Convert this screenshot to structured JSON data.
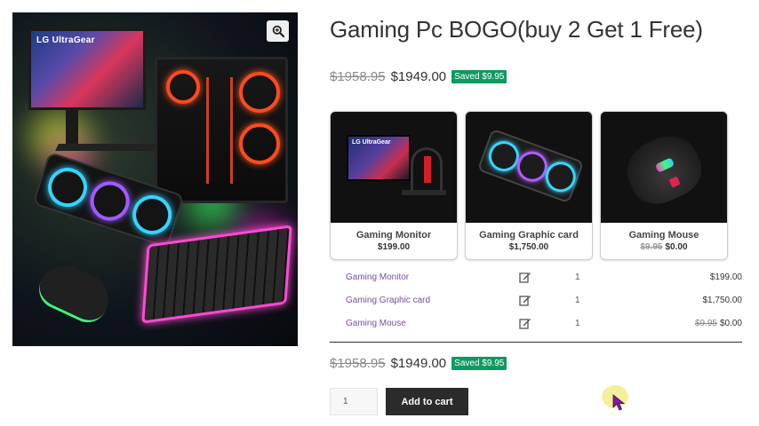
{
  "product": {
    "title": "Gaming Pc BOGO(buy 2 Get 1 Free)",
    "hero_image_brand": "LG UltraGear"
  },
  "pricing_top": {
    "old_price": "$1958.95",
    "new_price": "$1949.00",
    "saved": "Saved $9.95"
  },
  "cards": [
    {
      "name": "Gaming Monitor",
      "price": "$199.00",
      "old_price": "",
      "image_brand": "LG UltraGear"
    },
    {
      "name": "Gaming Graphic card",
      "price": "$1,750.00",
      "old_price": ""
    },
    {
      "name": "Gaming Mouse",
      "price": "$0.00",
      "old_price": "$9.95"
    }
  ],
  "bundle_rows": [
    {
      "name": "Gaming Monitor",
      "qty": "1",
      "old_price": "",
      "price": "$199.00",
      "edit_icon": "edit-icon"
    },
    {
      "name": "Gaming Graphic card",
      "qty": "1",
      "old_price": "",
      "price": "$1,750.00",
      "edit_icon": "edit-icon"
    },
    {
      "name": "Gaming Mouse",
      "qty": "1",
      "old_price": "$9.95",
      "price": "$0.00",
      "edit_icon": "edit-icon"
    }
  ],
  "pricing_bottom": {
    "old_price": "$1958.95",
    "new_price": "$1949.00",
    "saved": "Saved $9.95"
  },
  "cart": {
    "quantity": "1",
    "add_to_cart_label": "Add to cart"
  },
  "icons": {
    "zoom": "zoom-in-icon",
    "cursor": "mouse-pointer-icon"
  },
  "colors": {
    "saved_badge": "#0f9960",
    "link_purple": "#7a4ea3",
    "button_dark": "#2b2b2b"
  }
}
